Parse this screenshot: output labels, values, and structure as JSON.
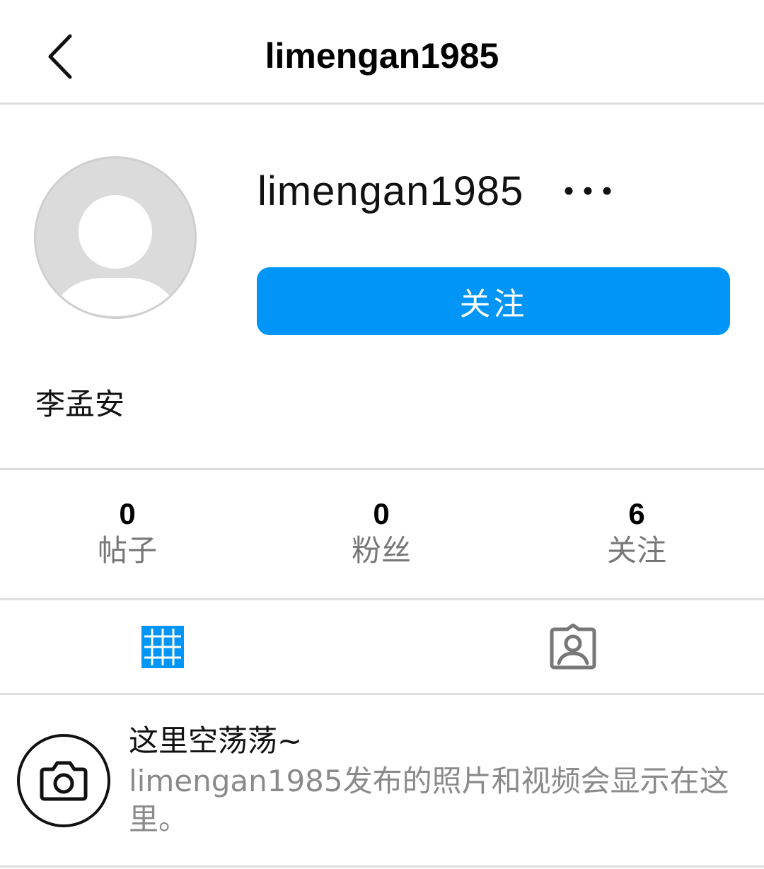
{
  "header": {
    "title": "limengan1985",
    "back_icon": "chevron-left-icon"
  },
  "profile": {
    "username": "limengan1985",
    "more_icon": "more-horizontal-icon",
    "follow_label": "关注",
    "display_name": "李孟安",
    "avatar_icon": "default-avatar-icon"
  },
  "stats": [
    {
      "value": "0",
      "label": "帖子"
    },
    {
      "value": "0",
      "label": "粉丝"
    },
    {
      "value": "6",
      "label": "关注"
    }
  ],
  "tabs": [
    {
      "icon": "grid-icon",
      "active": true
    },
    {
      "icon": "tagged-person-icon",
      "active": false
    }
  ],
  "empty_state": {
    "icon": "camera-icon",
    "title": "这里空荡荡~",
    "description": "limengan1985发布的照片和视频会显示在这里。"
  },
  "colors": {
    "accent": "#0095f6",
    "text_primary": "#111111",
    "text_secondary": "#777777",
    "divider": "#dedede",
    "avatar_bg": "#dbdbdb"
  }
}
